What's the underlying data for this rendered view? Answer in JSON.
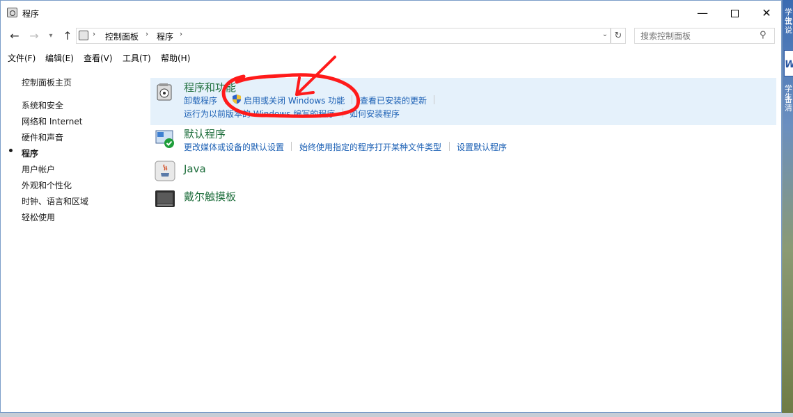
{
  "window": {
    "title": "程序"
  },
  "address": {
    "crumbs": [
      "控制面板",
      "程序"
    ],
    "search_placeholder": "搜索控制面板"
  },
  "menu": [
    "文件(F)",
    "编辑(E)",
    "查看(V)",
    "工具(T)",
    "帮助(H)"
  ],
  "leftnav": {
    "items": [
      "控制面板主页",
      "系统和安全",
      "网络和 Internet",
      "硬件和声音",
      "程序",
      "用户帐户",
      "外观和个性化",
      "时钟、语言和区域",
      "轻松使用"
    ],
    "selected": "程序"
  },
  "categories": {
    "programs_features": {
      "title": "程序和功能",
      "links": [
        "卸载程序",
        "启用或关闭 Windows 功能",
        "查看已安装的更新",
        "运行为以前版本的 Windows 编写的程序",
        "如何安装程序"
      ]
    },
    "default_programs": {
      "title": "默认程序",
      "links": [
        "更改媒体或设备的默认设置",
        "始终使用指定的程序打开某种文件类型",
        "设置默认程序"
      ]
    },
    "java": {
      "title": "Java"
    },
    "dell_touchpad": {
      "title": "戴尔触摸板"
    }
  },
  "desktop": {
    "fragments": [
      "学生",
      "试说",
      "学生",
      "备清"
    ]
  },
  "colors": {
    "link": "#1a5fb4",
    "category_title": "#1e6e3c",
    "highlight": "#e5f1fb",
    "annotation": "#ff1a1a"
  }
}
